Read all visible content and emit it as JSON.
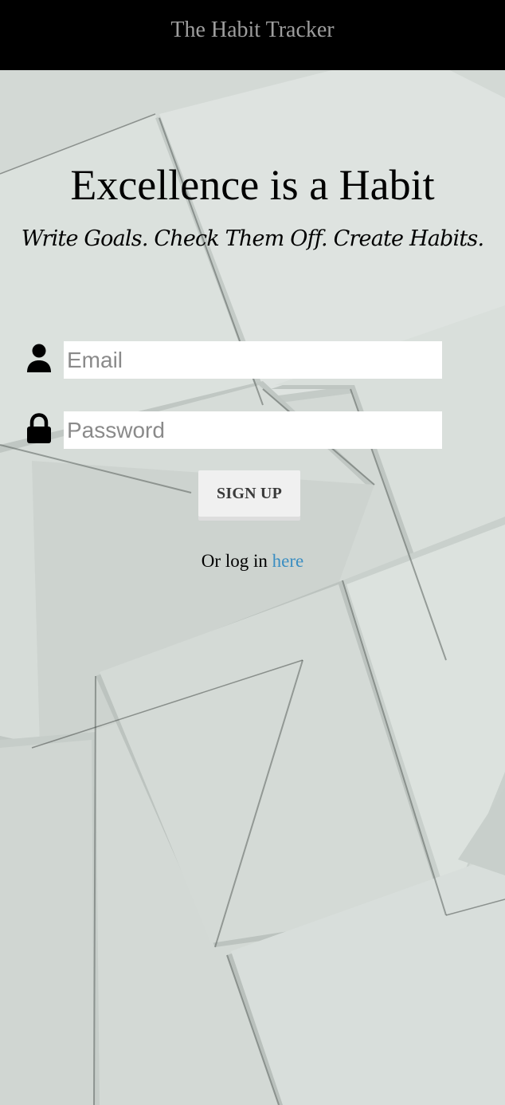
{
  "navbar": {
    "brand": "The Habit Tracker"
  },
  "hero": {
    "title": "Excellence is a Habit",
    "subtitle": "Write Goals. Check Them Off. Create Habits."
  },
  "form": {
    "email": {
      "icon": "user-icon",
      "placeholder": "Email",
      "value": ""
    },
    "password": {
      "icon": "lock-icon",
      "placeholder": "Password",
      "value": ""
    },
    "submit_label": "SIGN UP"
  },
  "login": {
    "prefix": "Or log in ",
    "link_label": "here"
  },
  "colors": {
    "navbar_bg": "#000000",
    "brand_text": "#9e9e9e",
    "link": "#3b8ec2",
    "button_bg": "#f0f0f0",
    "background": "#d6dcd8"
  }
}
